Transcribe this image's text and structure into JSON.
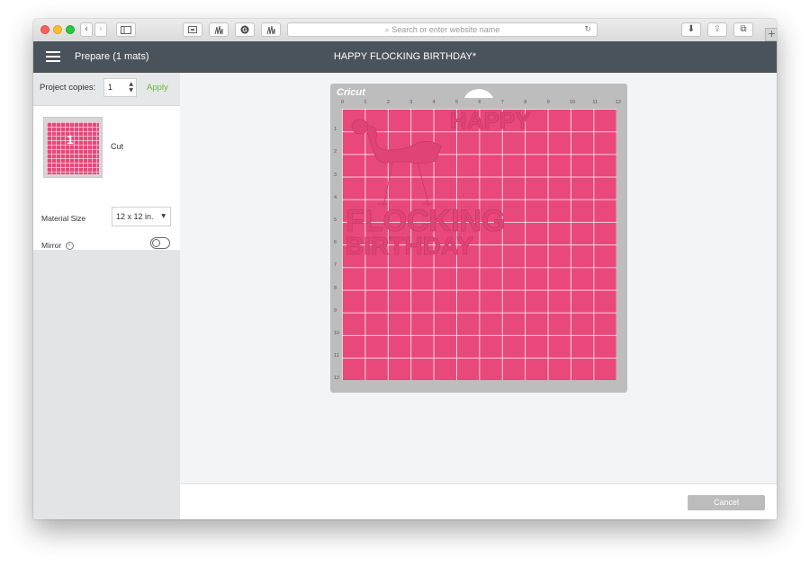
{
  "browser": {
    "address_placeholder": "Search or enter website name",
    "back_icon": "‹",
    "forward_icon": "›",
    "reload_icon": "↻",
    "new_tab_icon": "+",
    "download_icon": "⬇",
    "share_icon": "⇪",
    "tabs_icon": "⧉"
  },
  "header": {
    "left_title": "Prepare (1 mats)",
    "center_title": "HAPPY FLOCKING BIRTHDAY*"
  },
  "sidebar": {
    "copies_label": "Project copies:",
    "copies_value": "1",
    "apply_label": "Apply",
    "mat_number": "1",
    "mat_action": "Cut",
    "material_size_label": "Material Size",
    "material_size_value": "12 x 12 in.",
    "mirror_label": "Mirror",
    "mirror_on": false
  },
  "mat": {
    "brand": "Cricut",
    "ruler_top": [
      "0",
      "1",
      "2",
      "3",
      "4",
      "5",
      "6",
      "7",
      "8",
      "9",
      "10",
      "11",
      "12"
    ],
    "ruler_left": [
      "1",
      "2",
      "3",
      "4",
      "5",
      "6",
      "7",
      "8",
      "9",
      "10",
      "11",
      "12"
    ],
    "design_lines": [
      "HAPPY",
      "FLOCKING",
      "BIRTHDAY"
    ],
    "color": "#e8487a"
  },
  "footer": {
    "cancel_label": "Cancel"
  }
}
